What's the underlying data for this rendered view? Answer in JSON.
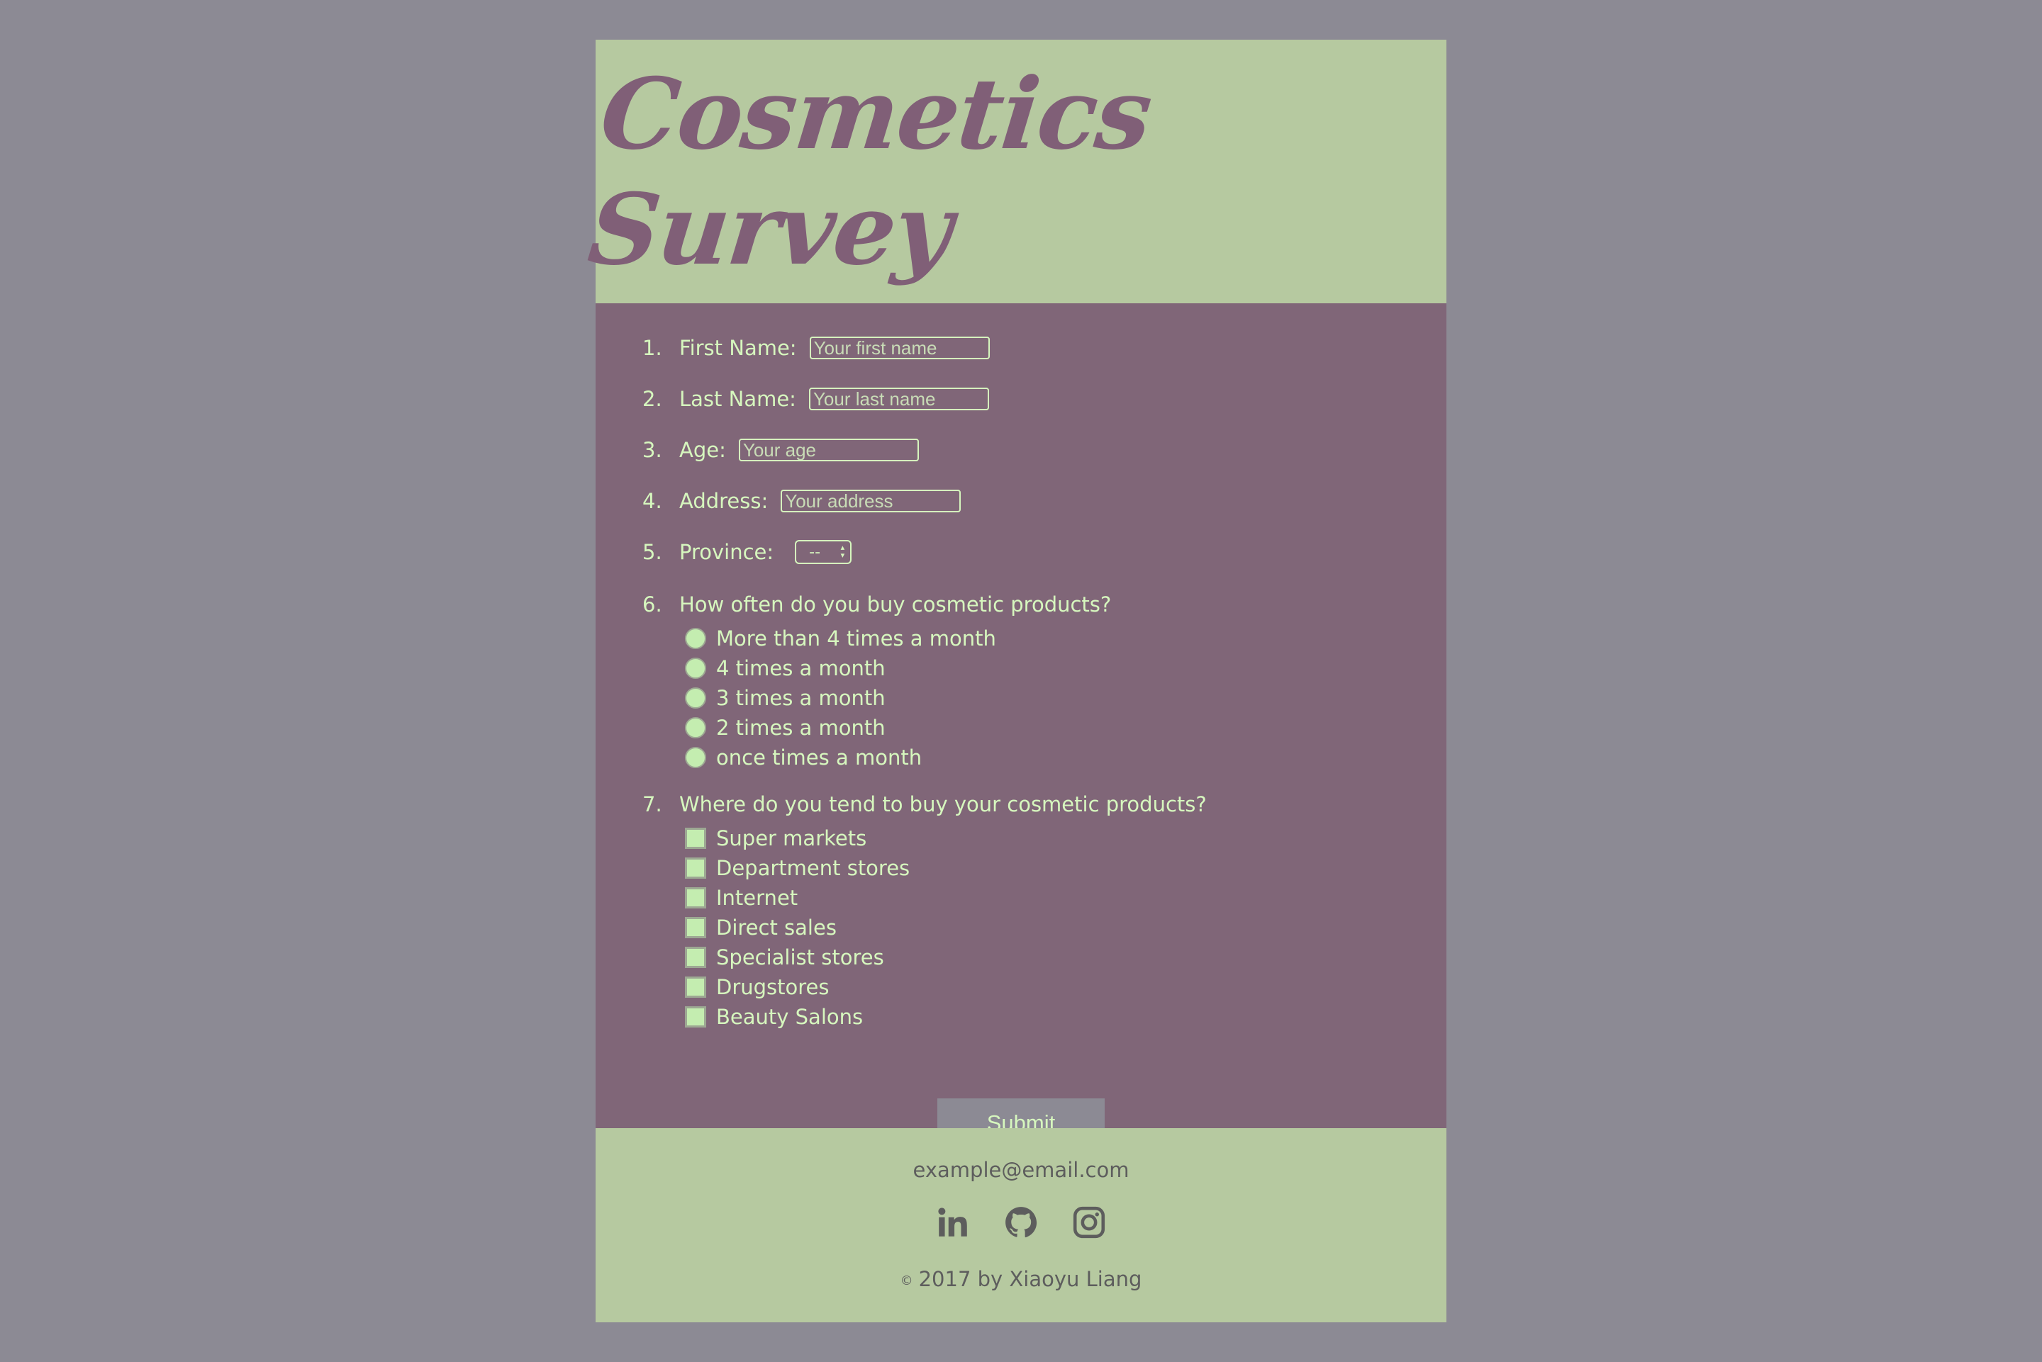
{
  "header": {
    "title": "Cosmetics Survey"
  },
  "form": {
    "questions": [
      {
        "number": "1.",
        "label": "First Name:",
        "placeholder": "Your first name"
      },
      {
        "number": "2.",
        "label": "Last Name:",
        "placeholder": "Your last name"
      },
      {
        "number": "3.",
        "label": "Age:",
        "placeholder": "Your age"
      },
      {
        "number": "4.",
        "label": "Address:",
        "placeholder": "Your address"
      },
      {
        "number": "5.",
        "label": "Province:",
        "selected": "--"
      },
      {
        "number": "6.",
        "label": "How often do you buy cosmetic products?"
      },
      {
        "number": "7.",
        "label": "Where do you tend to buy your cosmetic products?"
      }
    ],
    "frequency_options": [
      "More than 4 times a month",
      "4 times a month",
      "3 times a month",
      "2 times a month",
      "once times a month"
    ],
    "place_options": [
      "Super markets",
      "Department stores",
      "Internet",
      "Direct sales",
      "Specialist stores",
      "Drugstores",
      "Beauty Salons"
    ],
    "submit_label": "Submit"
  },
  "footer": {
    "email": "example@email.com",
    "icons": [
      "linkedin-icon",
      "github-icon",
      "instagram-icon"
    ],
    "copyright_symbol": "©",
    "copyright": "2017 by Xiaoyu Liang"
  },
  "colors": {
    "background": "#8c8a94",
    "header_bg": "#b6c9a0",
    "form_bg": "#806678",
    "accent_text": "#d6f7be",
    "title": "#805f77",
    "footer_text": "#5d5d5d"
  }
}
